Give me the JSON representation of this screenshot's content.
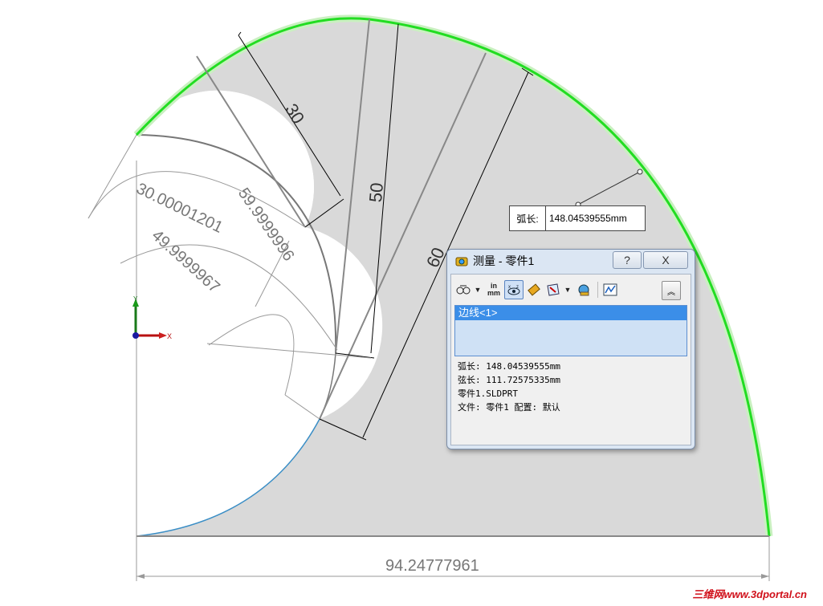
{
  "window": {
    "width": 1025,
    "height": 755
  },
  "model": {
    "fill_color": "#d9d9d9",
    "selected_edge_color": "#22dd22",
    "dimensions": {
      "d30": "30",
      "d50": "50",
      "d60": "60",
      "arc_30": "30.00001201",
      "arc_60": "59.9999996",
      "arc_50": "49.9999967",
      "base": "94.24777961"
    }
  },
  "callout": {
    "label": "弧长:",
    "value": "148.04539555mm"
  },
  "measure_dialog": {
    "title": "测量 - 零件1",
    "help_label": "?",
    "close_label": "X",
    "toolbar": {
      "arc_options_icon": "arc-condition-icon",
      "units_label_top": "in",
      "units_label_bottom": "mm",
      "show_xyz_icon": "show-xyz-icon",
      "point_to_point_icon": "point-to-point-icon",
      "projection_icon": "projection-icon",
      "history_icon": "measure-history-icon",
      "create_sensor_icon": "sensor-icon",
      "collapse_label": "︽"
    },
    "selection": [
      "边线<1>"
    ],
    "results": [
      "弧长: 148.04539555mm",
      "弦长: 111.72575335mm",
      "零件1.SLDPRT",
      "文件: 零件1 配置: 默认"
    ]
  },
  "triad": {
    "y_label": "Y",
    "x_label": "X"
  },
  "watermark": "三维网www.3dportal.cn"
}
